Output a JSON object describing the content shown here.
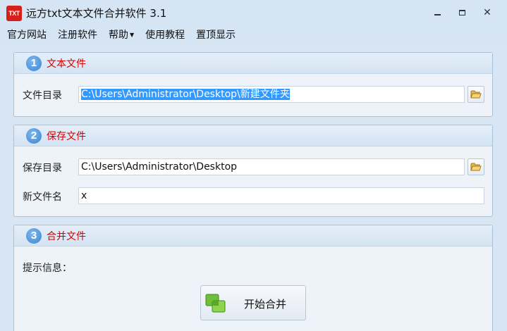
{
  "window": {
    "icon_text": "TXT",
    "title": "远方txt文本文件合并软件 3.1"
  },
  "menu": {
    "items": [
      "官方网站",
      "注册软件",
      "帮助",
      "使用教程",
      "置顶显示"
    ],
    "help_has_dropdown": true
  },
  "section1": {
    "number": "1",
    "title": "文本文件",
    "dir_label": "文件目录",
    "dir_value": "C:\\Users\\Administrator\\Desktop\\新建文件夹"
  },
  "section2": {
    "number": "2",
    "title": "保存文件",
    "dir_label": "保存目录",
    "dir_value": "C:\\Users\\Administrator\\Desktop",
    "name_label": "新文件名",
    "name_value": "x"
  },
  "section3": {
    "number": "3",
    "title": "合并文件",
    "info_label": "提示信息：",
    "merge_button": "开始合并"
  },
  "colors": {
    "accent_red": "#d40000",
    "step_blue": "#3a86d3",
    "selection": "#3399ff",
    "app_icon_red": "#d6201b"
  },
  "icons": [
    "app-icon",
    "minimize-icon",
    "maximize-icon",
    "close-icon",
    "folder-open-icon",
    "merge-icon"
  ]
}
